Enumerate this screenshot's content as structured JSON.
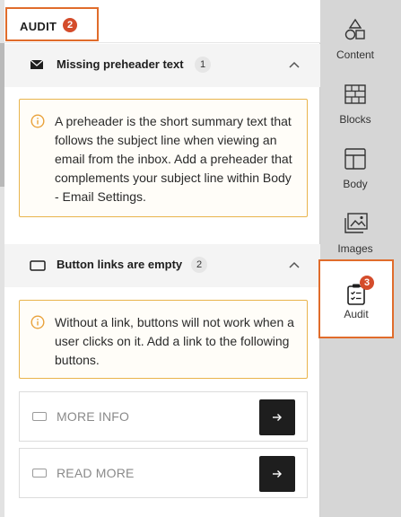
{
  "header": {
    "tab_label": "AUDIT",
    "tab_badge": "2"
  },
  "sections": [
    {
      "title": "Missing preheader text",
      "count": "1",
      "icon": "envelope-icon",
      "message": "A preheader is the short summary text that follows the subject line when viewing an email from the inbox. Add a preheader that complements your subject line within Body - Email Settings."
    },
    {
      "title": "Button links are empty",
      "count": "2",
      "icon": "button-outline-icon",
      "message": "Without a link, buttons will not work when a user clicks on it. Add a link to the following buttons.",
      "buttons": [
        {
          "label": "MORE INFO"
        },
        {
          "label": "READ MORE"
        }
      ]
    }
  ],
  "sidebar": {
    "items": [
      {
        "label": "Content",
        "icon": "shapes-icon"
      },
      {
        "label": "Blocks",
        "icon": "bricks-icon"
      },
      {
        "label": "Body",
        "icon": "layout-icon"
      },
      {
        "label": "Images",
        "icon": "image-icon"
      },
      {
        "label": "Audit",
        "icon": "clipboard-check-icon",
        "badge": "3",
        "active": true
      }
    ]
  },
  "colors": {
    "accent": "#e06c2b",
    "badge": "#d44c2b",
    "info_border": "#e9b44c",
    "dark_button": "#1e1e1e"
  }
}
